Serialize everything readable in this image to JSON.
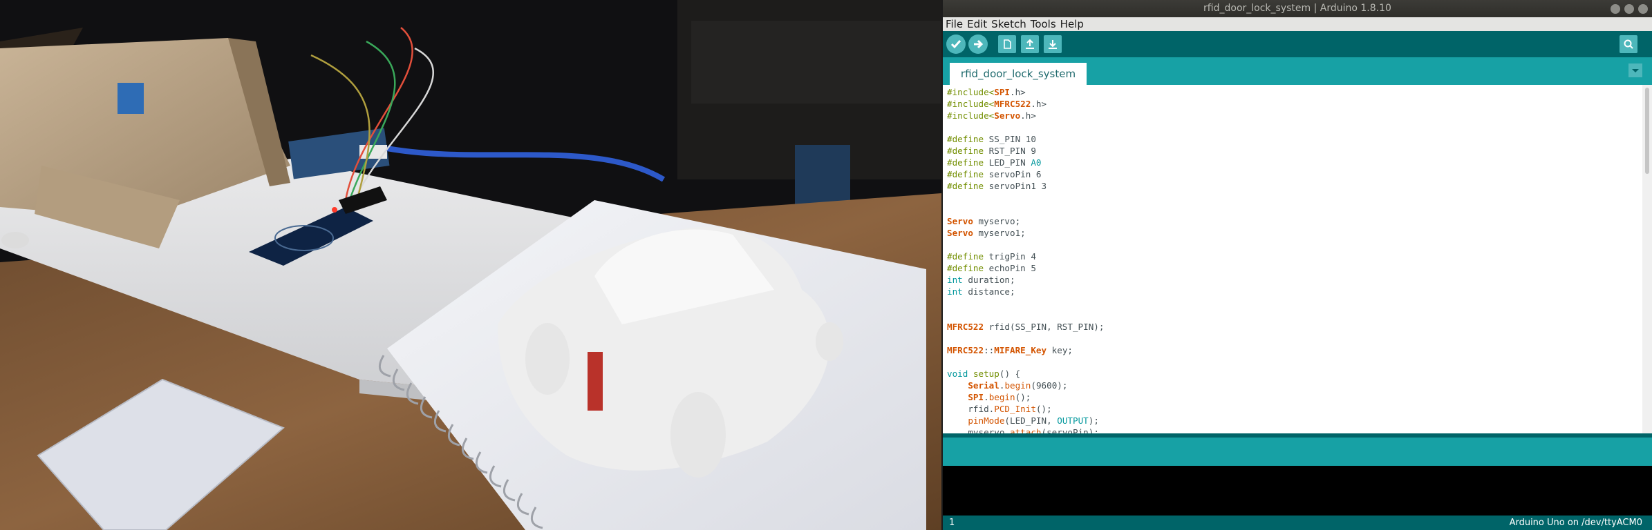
{
  "window": {
    "title": "rfid_door_lock_system | Arduino 1.8.10"
  },
  "menu": [
    "File",
    "Edit",
    "Sketch",
    "Tools",
    "Help"
  ],
  "toolbar": {
    "buttons": [
      "verify-icon",
      "upload-icon",
      "new-icon",
      "open-icon",
      "save-icon"
    ],
    "serial_monitor": "magnifier-icon"
  },
  "tabs": {
    "active": "rfid_door_lock_system"
  },
  "editor": {
    "lines": [
      [
        {
          "t": "#include<",
          "c": "kw"
        },
        {
          "t": "SPI",
          "c": "cl"
        },
        {
          "t": ".h>",
          "c": ""
        }
      ],
      [
        {
          "t": "#include<",
          "c": "kw"
        },
        {
          "t": "MFRC522",
          "c": "cl"
        },
        {
          "t": ".h>",
          "c": ""
        }
      ],
      [
        {
          "t": "#include<",
          "c": "kw"
        },
        {
          "t": "Servo",
          "c": "cl"
        },
        {
          "t": ".h>",
          "c": ""
        }
      ],
      [],
      [
        {
          "t": "#define",
          "c": "kw"
        },
        {
          "t": " SS_PIN 10",
          "c": ""
        }
      ],
      [
        {
          "t": "#define",
          "c": "kw"
        },
        {
          "t": " RST_PIN 9",
          "c": ""
        }
      ],
      [
        {
          "t": "#define",
          "c": "kw"
        },
        {
          "t": " LED_PIN ",
          "c": ""
        },
        {
          "t": "A0",
          "c": "ty"
        }
      ],
      [
        {
          "t": "#define",
          "c": "kw"
        },
        {
          "t": " servoPin 6",
          "c": ""
        }
      ],
      [
        {
          "t": "#define",
          "c": "kw"
        },
        {
          "t": " servoPin1 3",
          "c": ""
        }
      ],
      [],
      [],
      [
        {
          "t": "Servo",
          "c": "cl"
        },
        {
          "t": " myservo;",
          "c": ""
        }
      ],
      [
        {
          "t": "Servo",
          "c": "cl"
        },
        {
          "t": " myservo1;",
          "c": ""
        }
      ],
      [],
      [
        {
          "t": "#define",
          "c": "kw"
        },
        {
          "t": " trigPin 4",
          "c": ""
        }
      ],
      [
        {
          "t": "#define",
          "c": "kw"
        },
        {
          "t": " echoPin 5",
          "c": ""
        }
      ],
      [
        {
          "t": "int",
          "c": "ty"
        },
        {
          "t": " duration;",
          "c": ""
        }
      ],
      [
        {
          "t": "int",
          "c": "ty"
        },
        {
          "t": " distance;",
          "c": ""
        }
      ],
      [],
      [],
      [
        {
          "t": "MFRC522",
          "c": "cl"
        },
        {
          "t": " rfid(SS_PIN, RST_PIN);",
          "c": ""
        }
      ],
      [],
      [
        {
          "t": "MFRC522",
          "c": "cl"
        },
        {
          "t": "::",
          "c": ""
        },
        {
          "t": "MIFARE_Key",
          "c": "cl"
        },
        {
          "t": " key;",
          "c": ""
        }
      ],
      [],
      [
        {
          "t": "void",
          "c": "ty"
        },
        {
          "t": " ",
          "c": ""
        },
        {
          "t": "setup",
          "c": "kw"
        },
        {
          "t": "() {",
          "c": ""
        }
      ],
      [
        {
          "t": "    ",
          "c": ""
        },
        {
          "t": "Serial",
          "c": "cl"
        },
        {
          "t": ".",
          "c": ""
        },
        {
          "t": "begin",
          "c": "fn"
        },
        {
          "t": "(9600);",
          "c": ""
        }
      ],
      [
        {
          "t": "    ",
          "c": ""
        },
        {
          "t": "SPI",
          "c": "cl"
        },
        {
          "t": ".",
          "c": ""
        },
        {
          "t": "begin",
          "c": "fn"
        },
        {
          "t": "();",
          "c": ""
        }
      ],
      [
        {
          "t": "    rfid.",
          "c": ""
        },
        {
          "t": "PCD_Init",
          "c": "fn"
        },
        {
          "t": "();",
          "c": ""
        }
      ],
      [
        {
          "t": "    ",
          "c": ""
        },
        {
          "t": "pinMode",
          "c": "fn"
        },
        {
          "t": "(LED_PIN, ",
          "c": ""
        },
        {
          "t": "OUTPUT",
          "c": "ty"
        },
        {
          "t": ");",
          "c": ""
        }
      ],
      [
        {
          "t": "    myservo.",
          "c": ""
        },
        {
          "t": "attach",
          "c": "fn"
        },
        {
          "t": "(servoPin);",
          "c": ""
        }
      ]
    ]
  },
  "status": {
    "line": "1",
    "board": "Arduino Uno on /dev/ttyACM0"
  },
  "colors": {
    "teal": "#17a1a5",
    "toolbar": "#006468",
    "keyword": "#728e00",
    "type": "#00979c",
    "class": "#d35400"
  }
}
